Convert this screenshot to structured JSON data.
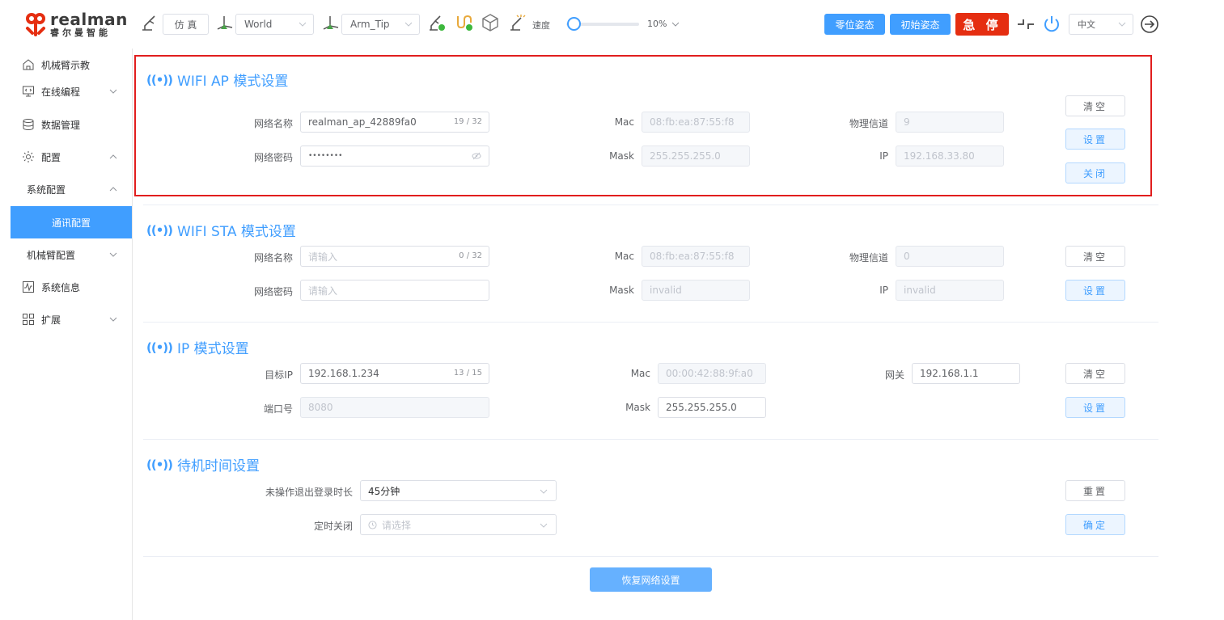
{
  "header": {
    "logo_en": "realman",
    "logo_cn": "睿尔曼智能",
    "sim_button": "仿 真",
    "frame_select": "World",
    "tool_select": "Arm_Tip",
    "speed_label": "速度",
    "speed_value": "10%",
    "speed_fraction": 0.1,
    "zero_pose_button": "零位姿态",
    "init_pose_button": "初始姿态",
    "estop_button": "急 停",
    "language_select": "中文",
    "colors": {
      "primary": "#409eff",
      "estop": "#e52e11",
      "logo_red": "#e52e11"
    }
  },
  "sidebar": {
    "items": [
      {
        "label": "机械臂示教",
        "icon": "home-icon"
      },
      {
        "label": "在线编程",
        "icon": "code-monitor-icon"
      },
      {
        "label": "数据管理",
        "icon": "database-icon"
      },
      {
        "label": "配置",
        "icon": "settings-icon"
      },
      {
        "label": "系统配置"
      },
      {
        "label": "通讯配置"
      },
      {
        "label": "机械臂配置"
      },
      {
        "label": "系统信息",
        "icon": "pulse-icon"
      },
      {
        "label": "扩展",
        "icon": "grid-icon"
      }
    ]
  },
  "ap": {
    "title": "WIFI AP 模式设置",
    "ssid_label": "网络名称",
    "ssid_value": "realman_ap_42889fa0",
    "ssid_count": "19 / 32",
    "pwd_label": "网络密码",
    "pwd_value": "••••••••",
    "mac_label": "Mac",
    "mac_value": "08:fb:ea:87:55:f8",
    "mask_label": "Mask",
    "mask_value": "255.255.255.0",
    "channel_label": "物理信道",
    "channel_value": "9",
    "ip_label": "IP",
    "ip_value": "192.168.33.80",
    "clear_btn": "清空",
    "set_btn": "设置",
    "close_btn": "关闭"
  },
  "sta": {
    "title": "WIFI STA 模式设置",
    "ssid_label": "网络名称",
    "ssid_placeholder": "请输入",
    "ssid_count": "0 / 32",
    "pwd_label": "网络密码",
    "pwd_placeholder": "请输入",
    "mac_label": "Mac",
    "mac_value": "08:fb:ea:87:55:f8",
    "mask_label": "Mask",
    "mask_value": "invalid",
    "channel_label": "物理信道",
    "channel_value": "0",
    "ip_label": "IP",
    "ip_value": "invalid",
    "clear_btn": "清空",
    "set_btn": "设置"
  },
  "ipmode": {
    "title": "IP 模式设置",
    "target_ip_label": "目标IP",
    "target_ip_value": "192.168.1.234",
    "target_ip_count": "13 / 15",
    "port_label": "端口号",
    "port_value": "8080",
    "mac_label": "Mac",
    "mac_value": "00:00:42:88:9f:a0",
    "mask_label": "Mask",
    "mask_value": "255.255.255.0",
    "gateway_label": "网关",
    "gateway_value": "192.168.1.1",
    "clear_btn": "清空",
    "set_btn": "设置"
  },
  "standby": {
    "title": "待机时间设置",
    "logout_label": "未操作退出登录时长",
    "logout_value": "45分钟",
    "shutdown_label": "定时关闭",
    "shutdown_placeholder": "请选择",
    "reset_btn": "重置",
    "confirm_btn": "确定"
  },
  "restore_button": "恢复网络设置"
}
